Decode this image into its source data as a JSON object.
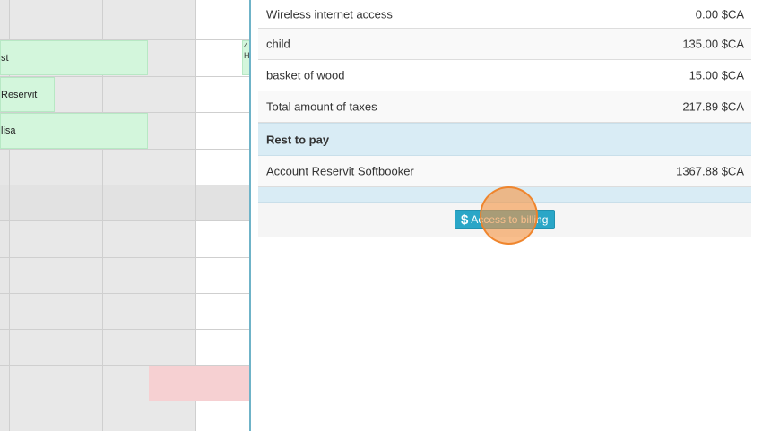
{
  "calendar": {
    "bookings": [
      {
        "label": "st"
      },
      {
        "label": "Reservit"
      },
      {
        "label": "lisa"
      }
    ],
    "small_booking_text": "4\nH"
  },
  "details": {
    "rows": [
      {
        "label": "Wireless internet access",
        "value": "0.00 $CA"
      },
      {
        "label": "child",
        "value": "135.00 $CA"
      },
      {
        "label": "basket of wood",
        "value": "15.00 $CA"
      },
      {
        "label": "Total amount of taxes",
        "value": "217.89 $CA"
      }
    ],
    "rest_to_pay_label": "Rest to pay",
    "account": {
      "label": "Account Reservit Softbooker",
      "value": "1367.88 $CA"
    },
    "billing_button": {
      "icon": "dollar-icon",
      "icon_glyph": "$",
      "label": "Access to billing"
    }
  },
  "colors": {
    "panel_border": "#6fb3c8",
    "header_bg": "#d9ecf5",
    "button_bg": "#2aa6c7",
    "booking_bg": "#d3f6dc",
    "blocked_bg": "#f6d0d2",
    "click_marker": "#f59646"
  }
}
